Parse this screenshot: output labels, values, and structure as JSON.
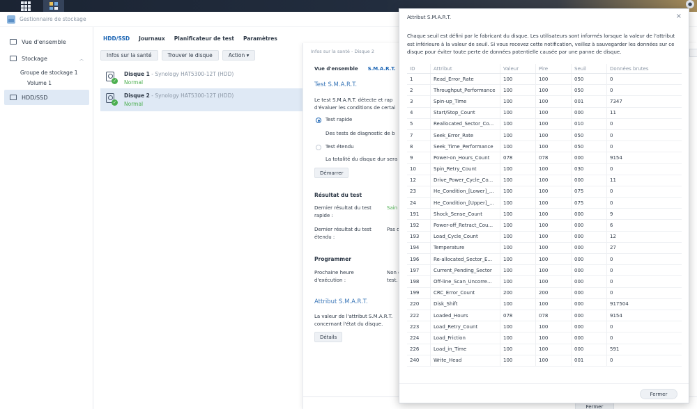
{
  "app": {
    "title": "Gestionnaire de stockage"
  },
  "sidebar": {
    "items": [
      {
        "label": "Vue d'ensemble"
      },
      {
        "label": "Stockage"
      },
      {
        "label": "HDD/SSD"
      }
    ],
    "sub": {
      "pool": "Groupe de stockage 1",
      "volume": "Volume 1"
    }
  },
  "tabs": [
    "HDD/SSD",
    "Journaux",
    "Planificateur de test",
    "Paramètres"
  ],
  "toolbar": {
    "health": "Infos sur la santé",
    "find": "Trouver le disque",
    "action": "Action ▾"
  },
  "disks": [
    {
      "name": "Disque 1",
      "model": " - Synology HAT5300-12T (HDD)",
      "status": "Normal"
    },
    {
      "name": "Disque 2",
      "model": " - Synology HAT5300-12T (HDD)",
      "status": "Normal"
    }
  ],
  "health": {
    "title": "Infos sur la santé - Disque 2",
    "tabs": [
      "Vue d'ensemble",
      "S.M.A.R.T."
    ],
    "smart_test_heading": "Test S.M.A.R.T.",
    "intro_l1": "Le test S.M.A.R.T. détecte et rap",
    "intro_l2": "d'évaluer les conditions de certai",
    "quick_label": "Test rapide",
    "quick_desc": "Des tests de diagnostic de b",
    "extended_label": "Test étendu",
    "extended_desc": "La totalité du disque dur sera",
    "start_btn": "Démarrer",
    "result_heading": "Résultat du test",
    "last_quick_l1": "Dernier résultat du test",
    "last_quick_l2": "rapide :",
    "last_quick_val": "Sain",
    "last_ext_l1": "Dernier résultat du test",
    "last_ext_l2": "étendu :",
    "last_ext_val": "Pas d",
    "schedule_heading": "Programmer",
    "next_l1": "Prochaine heure",
    "next_l2": "d'exécution :",
    "next_val_l1": "Non c",
    "next_val_l2": "test.",
    "attr_heading": "Attribut S.M.A.R.T.",
    "attr_l1": "La valeur de l'attribut S.M.A.R.T.",
    "attr_l2": "concernant l'état du disque.",
    "details_btn": "Détails",
    "close_btn": "Fermer"
  },
  "dialog": {
    "title": "Attribut S.M.A.R.T.",
    "close_icon": "×",
    "description": "Chaque seuil est défini par le fabricant du disque. Les utilisateurs sont informés lorsque la valeur de l'attribut est inférieure à la valeur de seuil. Si vous recevez cette notification, veillez à sauvegarder les données sur ce disque pour éviter toute perte de données potentielle causée par une panne de disque.",
    "columns": [
      "ID",
      "Attribut",
      "Valeur",
      "Pire",
      "Seuil",
      "Données brutes"
    ],
    "rows": [
      [
        "1",
        "Read_Error_Rate",
        "100",
        "100",
        "050",
        "0"
      ],
      [
        "2",
        "Throughput_Performance",
        "100",
        "100",
        "050",
        "0"
      ],
      [
        "3",
        "Spin-up_Time",
        "100",
        "100",
        "001",
        "7347"
      ],
      [
        "4",
        "Start/Stop_Count",
        "100",
        "100",
        "000",
        "11"
      ],
      [
        "5",
        "Reallocated_Sector_Co...",
        "100",
        "100",
        "010",
        "0"
      ],
      [
        "7",
        "Seek_Error_Rate",
        "100",
        "100",
        "050",
        "0"
      ],
      [
        "8",
        "Seek_Time_Performance",
        "100",
        "100",
        "050",
        "0"
      ],
      [
        "9",
        "Power-on_Hours_Count",
        "078",
        "078",
        "000",
        "9154"
      ],
      [
        "10",
        "Spin_Retry_Count",
        "100",
        "100",
        "030",
        "0"
      ],
      [
        "12",
        "Drive_Power_Cycle_Co...",
        "100",
        "100",
        "000",
        "11"
      ],
      [
        "23",
        "He_Condition_[Lower]_...",
        "100",
        "100",
        "075",
        "0"
      ],
      [
        "24",
        "He_Condition_[Upper]_...",
        "100",
        "100",
        "075",
        "0"
      ],
      [
        "191",
        "Shock_Sense_Count",
        "100",
        "100",
        "000",
        "9"
      ],
      [
        "192",
        "Power-off_Retract_Cou...",
        "100",
        "100",
        "000",
        "6"
      ],
      [
        "193",
        "Load_Cycle_Count",
        "100",
        "100",
        "000",
        "12"
      ],
      [
        "194",
        "Temperature",
        "100",
        "100",
        "000",
        "27"
      ],
      [
        "196",
        "Re-allocated_Sector_E...",
        "100",
        "100",
        "000",
        "0"
      ],
      [
        "197",
        "Current_Pending_Sector",
        "100",
        "100",
        "000",
        "0"
      ],
      [
        "198",
        "Off-line_Scan_Uncorre...",
        "100",
        "100",
        "000",
        "0"
      ],
      [
        "199",
        "CRC_Error_Count",
        "200",
        "200",
        "000",
        "0"
      ],
      [
        "220",
        "Disk_Shift",
        "100",
        "100",
        "000",
        "917504"
      ],
      [
        "222",
        "Loaded_Hours",
        "078",
        "078",
        "000",
        "9154"
      ],
      [
        "223",
        "Load_Retry_Count",
        "100",
        "100",
        "000",
        "0"
      ],
      [
        "224",
        "Load_Friction",
        "100",
        "100",
        "000",
        "0"
      ],
      [
        "226",
        "Load_in_Time",
        "100",
        "100",
        "000",
        "591"
      ],
      [
        "240",
        "Write_Head",
        "100",
        "100",
        "001",
        "0"
      ]
    ],
    "footer_btn": "Fermer"
  }
}
